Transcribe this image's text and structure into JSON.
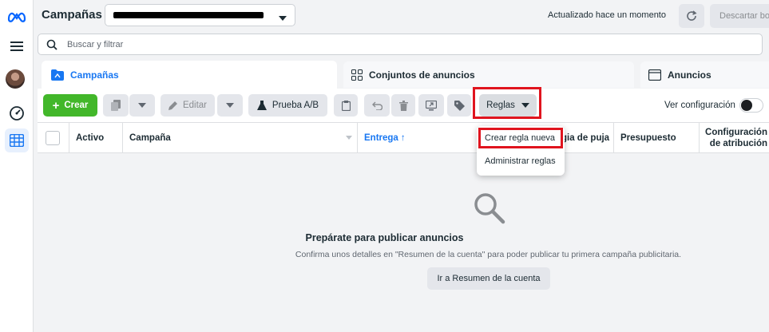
{
  "header": {
    "title": "Campañas",
    "updated_text": "Actualizado hace un momento",
    "discard_label": "Descartar bo"
  },
  "search": {
    "placeholder": "Buscar y filtrar"
  },
  "tabs": [
    {
      "label": "Campañas",
      "active": true
    },
    {
      "label": "Conjuntos de anuncios",
      "active": false
    },
    {
      "label": "Anuncios",
      "active": false
    }
  ],
  "toolbar": {
    "create_label": "Crear",
    "edit_label": "Editar",
    "ab_test_label": "Prueba A/B",
    "rules_label": "Reglas",
    "view_config_label": "Ver configuración"
  },
  "rules_menu": {
    "items": [
      {
        "label": "Crear regla nueva",
        "highlighted": true
      },
      {
        "label": "Administrar reglas",
        "highlighted": false
      }
    ]
  },
  "table": {
    "columns": [
      "Activo",
      "Campaña",
      "Entrega",
      "gia de puja",
      "Presupuesto",
      "Configuración",
      "de atribución"
    ],
    "sort_indicator": "↑"
  },
  "empty_state": {
    "title": "Prepárate para publicar anuncios",
    "description": "Confirma unos detalles en \"Resumen de la cuenta\" para poder publicar tu primera campaña publicitaria.",
    "button_label": "Ir a Resumen de la cuenta"
  },
  "colors": {
    "primary": "#1877f2",
    "create_green": "#42b72a",
    "highlight_red": "#e0141e"
  }
}
